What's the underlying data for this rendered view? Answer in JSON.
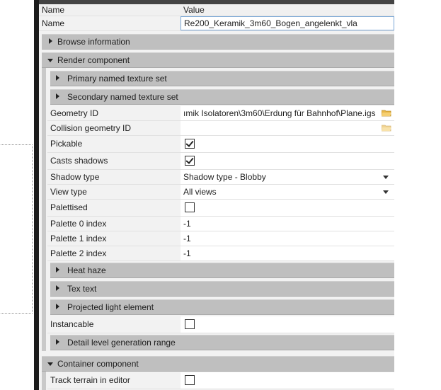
{
  "header": {
    "name_col": "Name",
    "value_col": "Value"
  },
  "name_row": {
    "label": "Name",
    "value": "Re200_Keramik_3m60_Bogen_angelenkt_vla"
  },
  "sections": {
    "browse_information": "Browse information",
    "render_component": "Render component",
    "primary_named_texture_set": "Primary named texture set",
    "secondary_named_texture_set": "Secondary named texture set",
    "heat_haze": "Heat haze",
    "tex_text": "Tex text",
    "projected_light_element": "Projected light element",
    "detail_level_generation_range": "Detail level generation range",
    "container_component": "Container component"
  },
  "properties": {
    "geometry_id": {
      "label": "Geometry ID",
      "value": "ımik Isolatoren\\3m60\\Erdung für Bahnhof\\Plane.igs"
    },
    "collision_geometry_id": {
      "label": "Collision geometry ID",
      "value": ""
    },
    "pickable": {
      "label": "Pickable",
      "checked": true
    },
    "casts_shadows": {
      "label": "Casts shadows",
      "checked": true
    },
    "shadow_type": {
      "label": "Shadow type",
      "value": "Shadow type - Blobby"
    },
    "view_type": {
      "label": "View type",
      "value": "All views"
    },
    "palettised": {
      "label": "Palettised",
      "checked": false
    },
    "palette_0_index": {
      "label": "Palette 0 index",
      "value": "-1"
    },
    "palette_1_index": {
      "label": "Palette 1 index",
      "value": "-1"
    },
    "palette_2_index": {
      "label": "Palette 2 index",
      "value": "-1"
    },
    "instancable": {
      "label": "Instancable",
      "checked": false
    },
    "track_terrain_in_editor": {
      "label": "Track terrain in editor",
      "checked": false
    }
  },
  "colors": {
    "section_bg": "#bfbfbf",
    "input_border": "#7aa7d6",
    "folder": "#e8b74a"
  },
  "icons": {
    "expand": "triangle-right-icon",
    "collapse": "triangle-down-icon",
    "browse": "folder-icon",
    "dropdown": "chevron-down-icon"
  }
}
